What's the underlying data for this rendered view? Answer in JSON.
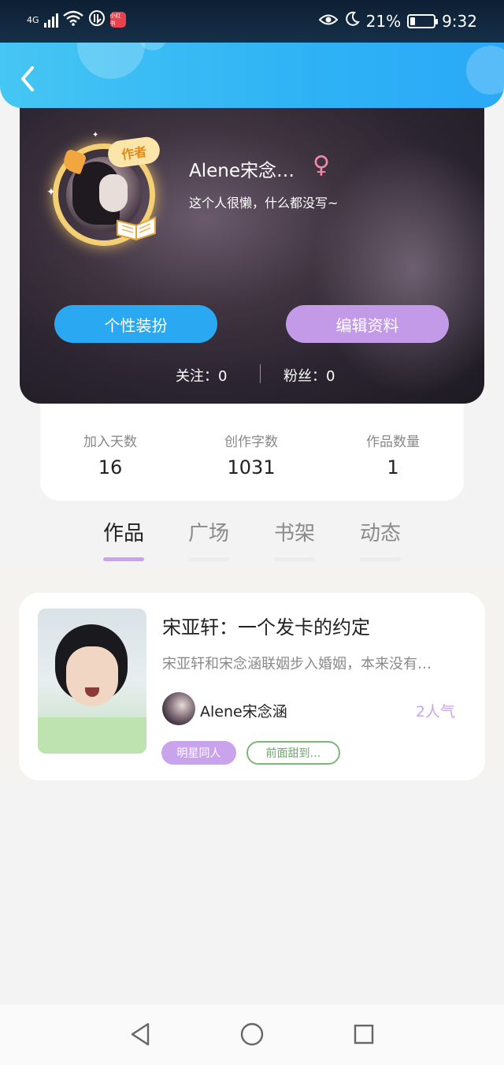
{
  "status_bar": {
    "network": "4G",
    "battery_percent": "21%",
    "time": "9:32",
    "badge_text": "小红书",
    "icons": [
      "signal-icon",
      "wifi-icon",
      "data-saver-icon",
      "app-badge-icon",
      "eye-comfort-icon",
      "moon-icon",
      "battery-icon"
    ],
    "battery_level": 0.21
  },
  "header": {
    "back_icon": "chevron-left-icon",
    "accent_color": "#2fb3f5"
  },
  "profile": {
    "author_badge": "作者",
    "nickname": "Alene宋念…",
    "gender_symbol": "♀",
    "signature": "这个人很懒，什么都没写~",
    "buttons": {
      "dress_up": "个性装扮",
      "edit_profile": "编辑资料"
    },
    "follow": {
      "following": "关注：0",
      "fans": "粉丝：0"
    }
  },
  "stats": [
    {
      "label": "加入天数",
      "value": "16"
    },
    {
      "label": "创作字数",
      "value": "1031"
    },
    {
      "label": "作品数量",
      "value": "1"
    }
  ],
  "tabs": [
    {
      "label": "作品",
      "active": true
    },
    {
      "label": "广场",
      "active": false
    },
    {
      "label": "书架",
      "active": false
    },
    {
      "label": "动态",
      "active": false
    }
  ],
  "works": [
    {
      "title": "宋亚轩：一个发卡的约定",
      "description": "宋亚轩和宋念涵联姻步入婚姻，本来没有…",
      "author": "Alene宋念涵",
      "popularity": "2人气",
      "tags": [
        "明星同人",
        "前面甜到…"
      ]
    }
  ],
  "nav_bar": {
    "icons": [
      "back-triangle-icon",
      "home-circle-icon",
      "recents-square-icon"
    ]
  },
  "colors": {
    "tab_active": "#c9a4ec",
    "button_blue": "#2aa8f2",
    "button_purple": "#c39ae8",
    "gender_pink": "#f08aa8"
  }
}
